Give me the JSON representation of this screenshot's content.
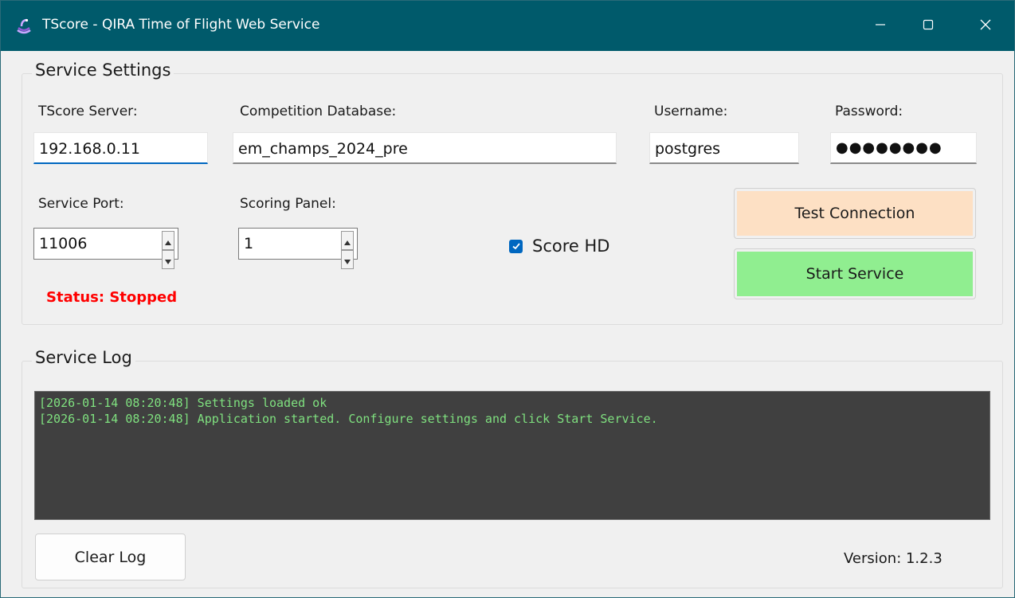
{
  "window": {
    "title": "TScore - QIRA Time of Flight Web Service",
    "titlebar_color": "#005a6b"
  },
  "settings": {
    "legend": "Service Settings",
    "server_label": "TScore Server:",
    "server_value": "192.168.0.11",
    "database_label": "Competition Database:",
    "database_value": "em_champs_2024_pre",
    "username_label": "Username:",
    "username_value": "postgres",
    "password_label": "Password:",
    "password_value": "●●●●●●●●",
    "port_label": "Service Port:",
    "port_value": "11006",
    "panel_label": "Scoring Panel:",
    "panel_value": "1",
    "scorehd_label": "Score HD",
    "scorehd_checked": true,
    "status_text": "Status: Stopped",
    "status_color": "#ff0000",
    "test_button": "Test Connection",
    "test_button_color": "#fde0c4",
    "start_button": "Start Service",
    "start_button_color": "#90ee90"
  },
  "log": {
    "legend": "Service Log",
    "lines": [
      "[2026-01-14 08:20:48] Settings loaded ok",
      "[2026-01-14 08:20:48] Application started. Configure settings and click Start Service."
    ],
    "text_color": "#7fe07f",
    "background": "#404040"
  },
  "footer": {
    "clear_button": "Clear Log",
    "version": "Version: 1.2.3"
  },
  "icons": {
    "app": "app-icon",
    "minimize": "minimize-icon",
    "maximize": "maximize-icon",
    "close": "close-icon"
  }
}
